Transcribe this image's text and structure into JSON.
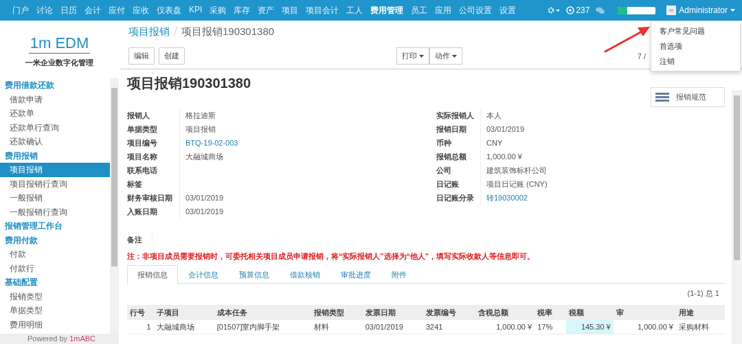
{
  "top_menu": [
    {
      "label": "门户",
      "selected": false
    },
    {
      "label": "讨论",
      "selected": false
    },
    {
      "label": "日历",
      "selected": false
    },
    {
      "label": "会计",
      "selected": false
    },
    {
      "label": "应付",
      "selected": false
    },
    {
      "label": "应收",
      "selected": false
    },
    {
      "label": "仪表盘",
      "selected": false
    },
    {
      "label": "KPI",
      "selected": false
    },
    {
      "label": "采购",
      "selected": false
    },
    {
      "label": "库存",
      "selected": false
    },
    {
      "label": "资产",
      "selected": false
    },
    {
      "label": "项目",
      "selected": false
    },
    {
      "label": "项目会计",
      "selected": false
    },
    {
      "label": "工人",
      "selected": false
    },
    {
      "label": "费用管理",
      "selected": true
    },
    {
      "label": "员工",
      "selected": false
    },
    {
      "label": "应用",
      "selected": false
    },
    {
      "label": "公司设置",
      "selected": false
    },
    {
      "label": "设置",
      "selected": false
    }
  ],
  "systray": {
    "message_count": "237",
    "progress": {
      "level": 0.25
    },
    "user": "Administrator"
  },
  "user_menu": [
    "客户常见问题",
    "首选项",
    "注销"
  ],
  "sidebar": {
    "logo": "1m EDM",
    "tagline": "一米企业数字化管理",
    "sections": [
      {
        "title": "费用借款还款",
        "items": [
          {
            "label": "借款申请",
            "selected": false
          },
          {
            "label": "还款单",
            "selected": false
          },
          {
            "label": "还款单行查询",
            "selected": false
          },
          {
            "label": "还款确认",
            "selected": false
          }
        ]
      },
      {
        "title": "费用报销",
        "items": [
          {
            "label": "项目报销",
            "selected": true
          },
          {
            "label": "项目报销行查询",
            "selected": false
          },
          {
            "label": "一般报销",
            "selected": false
          },
          {
            "label": "一般报销行查询",
            "selected": false
          }
        ]
      },
      {
        "title": "报销管理工作台"
      },
      {
        "title": "费用付款",
        "items": [
          {
            "label": "付款",
            "selected": false
          },
          {
            "label": "付款行",
            "selected": false
          }
        ]
      },
      {
        "title": "基础配置",
        "items": [
          {
            "label": "报销类型",
            "selected": false
          },
          {
            "label": "单据类型",
            "selected": false
          },
          {
            "label": "费用明细",
            "selected": false
          }
        ]
      }
    ],
    "footer_prefix": "Powered by",
    "footer_brand": "1mABC"
  },
  "breadcrumb": [
    "项目报销",
    "项目报销190301380"
  ],
  "buttons": [
    "编辑",
    "创建"
  ],
  "dropdowns": [
    "打印",
    "动作"
  ],
  "pager": "7 /",
  "form": {
    "title": "项目报销190301380",
    "side_button": "报销规范",
    "left_fields": [
      {
        "label": "报销人",
        "value": "格拉迪斯",
        "kind": "text"
      },
      {
        "label": "单据类型",
        "value": "项目报销",
        "kind": "text"
      },
      {
        "label": "项目编号",
        "value": "BTQ-19-02-003",
        "kind": "link"
      },
      {
        "label": "项目名称",
        "value": "大融城商场",
        "kind": "text"
      },
      {
        "label": "联系电话"
      },
      {
        "label": "标签"
      },
      {
        "label": "财务审核日期",
        "value": "03/01/2019",
        "kind": "text"
      },
      {
        "label": "入账日期",
        "value": "03/01/2019",
        "kind": "text"
      }
    ],
    "right_fields": [
      {
        "label": "实际报销人",
        "value": "本人",
        "kind": "text"
      },
      {
        "label": "报销日期",
        "value": "03/01/2019",
        "kind": "text"
      },
      {
        "label": "币种",
        "value": "CNY",
        "kind": "text"
      },
      {
        "label": "报销总额",
        "value": "1,000.00 ¥",
        "kind": "text"
      },
      {
        "label": "公司",
        "value": "建筑装饰标杆公司",
        "kind": "text"
      },
      {
        "label": "日记账",
        "value": "项目日记账 (CNY)",
        "kind": "text"
      },
      {
        "label": "日记账分录",
        "value": "转19030002",
        "kind": "link"
      }
    ],
    "note_label": "备注",
    "warning": "注：非项目成员需要报销时，可委托相关项目成员申请报销，将“实际报销人”选择为“他人”，填写实际收款人等信息即可。",
    "tabs": [
      {
        "label": "报销信息",
        "selected": true
      },
      {
        "label": "会计信息",
        "selected": false
      },
      {
        "label": "预算信息",
        "selected": false
      },
      {
        "label": "借款核销",
        "selected": false
      },
      {
        "label": "审批进度",
        "selected": false
      },
      {
        "label": "附件",
        "selected": false
      }
    ],
    "table_pager": "(1-1) 总 1",
    "table": {
      "columns": [
        {
          "label": "行号",
          "kind": "number"
        },
        {
          "label": "子项目",
          "kind": "text"
        },
        {
          "label": "成本任务",
          "kind": "text"
        },
        {
          "label": "报销类型",
          "kind": "text"
        },
        {
          "label": "发票日期",
          "kind": "text"
        },
        {
          "label": "发票编号",
          "kind": "text"
        },
        {
          "label": "含税总额",
          "kind": "number"
        },
        {
          "label": "税率",
          "kind": "text"
        },
        {
          "label": "税额",
          "kind": "number",
          "highlight": true
        },
        {
          "label": "审",
          "kind": "number"
        },
        {
          "label": "用途",
          "kind": "text"
        }
      ],
      "rows": [
        [
          "1",
          "大融城商场",
          "[01507]室内脚手架",
          "材料",
          "03/01/2019",
          "3241",
          "1,000.00 ¥",
          "17%",
          "145.30 ¥",
          "1,000.00 ¥",
          "采购材料"
        ]
      ]
    }
  }
}
